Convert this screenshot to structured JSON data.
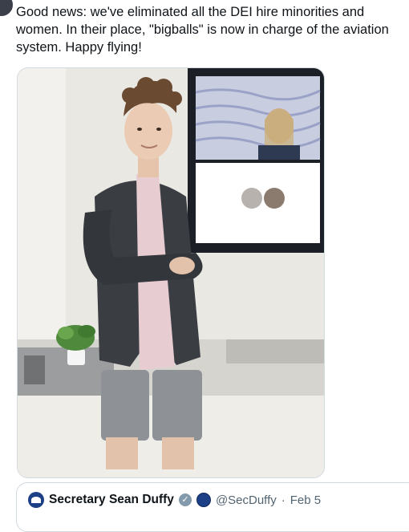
{
  "tweet": {
    "text": "Good news: we've eliminated all the DEI hire minorities and women. In their place, \"bigballs\" is now in charge of the aviation system. Happy flying!",
    "photo_icon": "photo-image"
  },
  "quoted_tweet": {
    "author_name": "Secretary Sean Duffy",
    "handle": "@SecDuffy",
    "separator": "·",
    "date": "Feb 5",
    "verified_icon": "gray-verified-badge-icon",
    "affiliation_icon": "dot-seal-icon",
    "avatar_icon": "avatar-icon"
  },
  "colors": {
    "text": "#0f1419",
    "secondary_text": "#536471",
    "border": "#cfd9de",
    "badge_gray": "#829aab"
  }
}
